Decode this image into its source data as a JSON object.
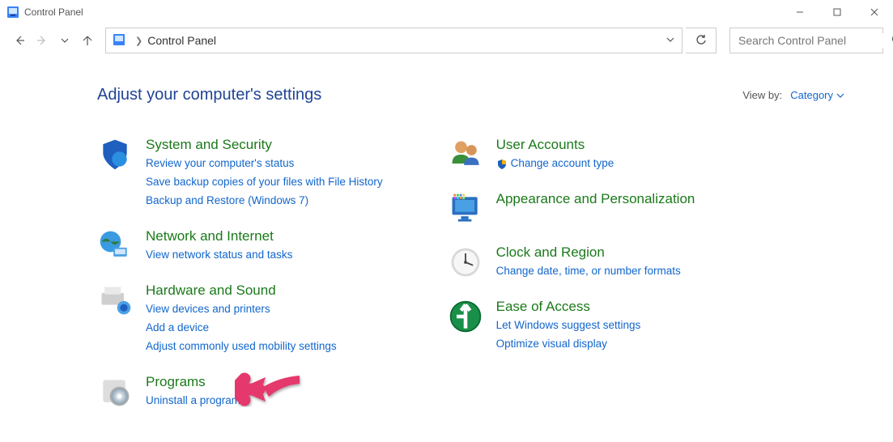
{
  "window": {
    "title": "Control Panel"
  },
  "nav": {
    "address_crumb": "Control Panel",
    "search_placeholder": "Search Control Panel"
  },
  "header": {
    "title": "Adjust your computer's settings",
    "viewby_label": "View by:",
    "viewby_value": "Category"
  },
  "left": {
    "system": {
      "title": "System and Security",
      "links": [
        "Review your computer's status",
        "Save backup copies of your files with File History",
        "Backup and Restore (Windows 7)"
      ]
    },
    "network": {
      "title": "Network and Internet",
      "link": "View network status and tasks"
    },
    "hardware": {
      "title": "Hardware and Sound",
      "links": [
        "View devices and printers",
        "Add a device",
        "Adjust commonly used mobility settings"
      ]
    },
    "programs": {
      "title": "Programs",
      "link": "Uninstall a program"
    }
  },
  "right": {
    "users": {
      "title": "User Accounts",
      "link": "Change account type"
    },
    "appearance": {
      "title": "Appearance and Personalization"
    },
    "clock": {
      "title": "Clock and Region",
      "link": "Change date, time, or number formats"
    },
    "ease": {
      "title": "Ease of Access",
      "links": [
        "Let Windows suggest settings",
        "Optimize visual display"
      ]
    }
  }
}
